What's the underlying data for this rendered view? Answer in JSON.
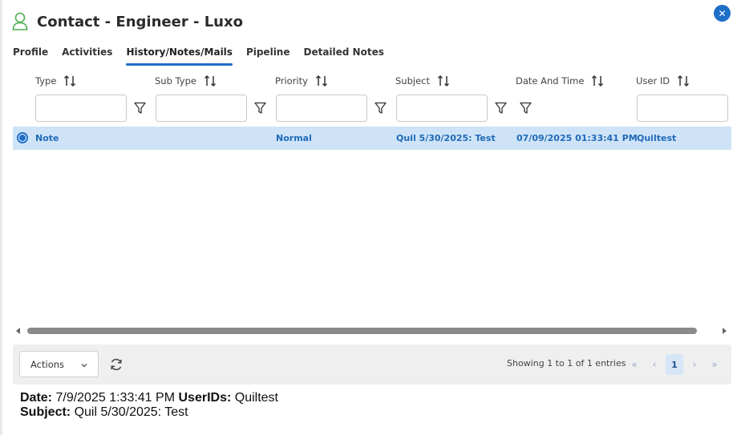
{
  "header": {
    "title": "Contact - Engineer - Luxo",
    "icon": "user-icon",
    "icon_color": "#4caf50"
  },
  "close_icon": "close-icon",
  "tabs": [
    {
      "label": "Profile",
      "active": false
    },
    {
      "label": "Activities",
      "active": false
    },
    {
      "label": "History/Notes/Mails",
      "active": true
    },
    {
      "label": "Pipeline",
      "active": false
    },
    {
      "label": "Detailed Notes",
      "active": false
    }
  ],
  "grid": {
    "columns": [
      {
        "label": "Type"
      },
      {
        "label": "Sub Type"
      },
      {
        "label": "Priority"
      },
      {
        "label": "Subject"
      },
      {
        "label": "Date And Time"
      },
      {
        "label": "User ID"
      }
    ],
    "rows": [
      {
        "selected": true,
        "type": "Note",
        "sub_type": "",
        "priority": "Normal",
        "subject": "Quil 5/30/2025: Test",
        "date_time": "07/09/2025 01:33:41 PM",
        "user_id": "Quiltest"
      }
    ],
    "selected_row_color": "#cfe3f8"
  },
  "footer": {
    "actions_label": "Actions",
    "showing_text": "Showing 1 to 1 of 1 entries",
    "pager": {
      "first": "«",
      "prev": "‹",
      "current": "1",
      "next": "›",
      "last": "»"
    }
  },
  "detail": {
    "date_label": "Date:",
    "date_value": "7/9/2025 1:33:41 PM",
    "userids_label": "UserIDs:",
    "userids_value": "Quiltest",
    "subject_label": "Subject:",
    "subject_value": "Quil 5/30/2025: Test"
  },
  "colors": {
    "accent": "#1e6fc8",
    "link_text": "#1f6ab7"
  }
}
